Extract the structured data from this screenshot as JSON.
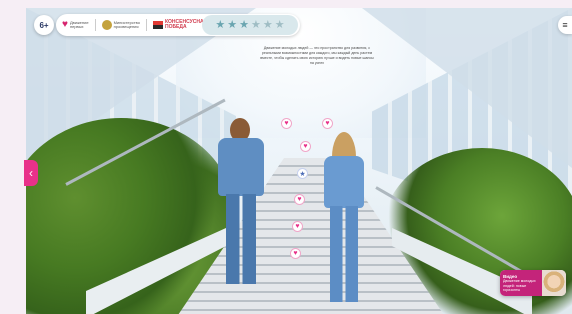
{
  "topbar": {
    "badge_text": "6+",
    "logos": [
      {
        "name": "prosveshchenie-logo",
        "lines": [
          "Движение",
          "первых"
        ]
      },
      {
        "name": "ministry-emblem-logo",
        "lines": [
          "Министерство",
          "просвещения"
        ]
      },
      {
        "name": "flag-logo",
        "lines": [
          "КОНСЕНСУСНАЯ",
          "ПОБЕДА"
        ]
      }
    ],
    "stars_total": 6,
    "stars_filled": 3,
    "accent_color": "#e8318a"
  },
  "intro_text": "Движение молодых людей — это пространство для развития, с реальными возможностями для каждого, мы каждый день растем вместе, чтобы сделать свою историю лучше и видеть новые шансы на успех",
  "markers": [
    {
      "icon": "heart-icon",
      "kind": "pink"
    },
    {
      "icon": "heart-icon",
      "kind": "pink"
    },
    {
      "icon": "heart-icon",
      "kind": "pink"
    },
    {
      "icon": "star-icon",
      "kind": "blue"
    },
    {
      "icon": "heart-icon",
      "kind": "pink"
    },
    {
      "icon": "heart-icon",
      "kind": "pink"
    },
    {
      "icon": "heart-icon",
      "kind": "pink"
    }
  ],
  "video_card": {
    "title": "Видео",
    "subtitle": "Движение молодых людей: новые горизонты"
  },
  "nav": {
    "prev_icon": "chevron-left-icon",
    "menu_icon": "menu-icon"
  }
}
